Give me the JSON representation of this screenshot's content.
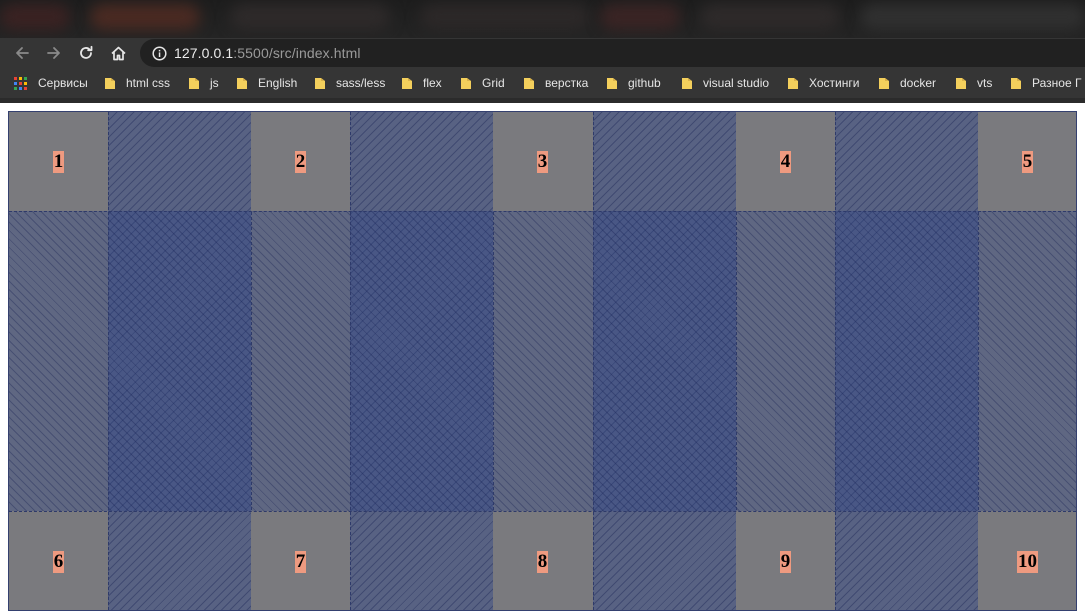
{
  "browser": {
    "address_bar": {
      "host": "127.0.0.1",
      "rest": ":5500/src/index.html"
    },
    "icons": {
      "back": "arrow-left-icon",
      "forward": "arrow-right-icon",
      "reload": "reload-icon",
      "home": "home-icon",
      "site_info": "info-icon"
    },
    "bookmarks": [
      {
        "label": "Сервисы",
        "icon": "apps-grid-icon"
      },
      {
        "label": "html css",
        "icon": "folder-icon"
      },
      {
        "label": "js",
        "icon": "folder-icon"
      },
      {
        "label": "English",
        "icon": "folder-icon"
      },
      {
        "label": "sass/less",
        "icon": "folder-icon"
      },
      {
        "label": "flex",
        "icon": "folder-icon"
      },
      {
        "label": "Grid",
        "icon": "folder-icon"
      },
      {
        "label": "верстка",
        "icon": "folder-icon"
      },
      {
        "label": "github",
        "icon": "folder-icon"
      },
      {
        "label": "visual studio",
        "icon": "folder-icon"
      },
      {
        "label": "Хостинги",
        "icon": "folder-icon"
      },
      {
        "label": "docker",
        "icon": "folder-icon"
      },
      {
        "label": "vts",
        "icon": "folder-icon"
      },
      {
        "label": "Разное Г",
        "icon": "folder-icon"
      }
    ]
  },
  "page": {
    "grid_items": [
      "1",
      "2",
      "3",
      "4",
      "5",
      "6",
      "7",
      "8",
      "9",
      "10"
    ]
  },
  "colors": {
    "grid_item_bg": "#7a7a7e",
    "number_label_bg": "#ee9a80",
    "grid_overlay": "#2f448a",
    "folder": "#f3cf5c"
  }
}
